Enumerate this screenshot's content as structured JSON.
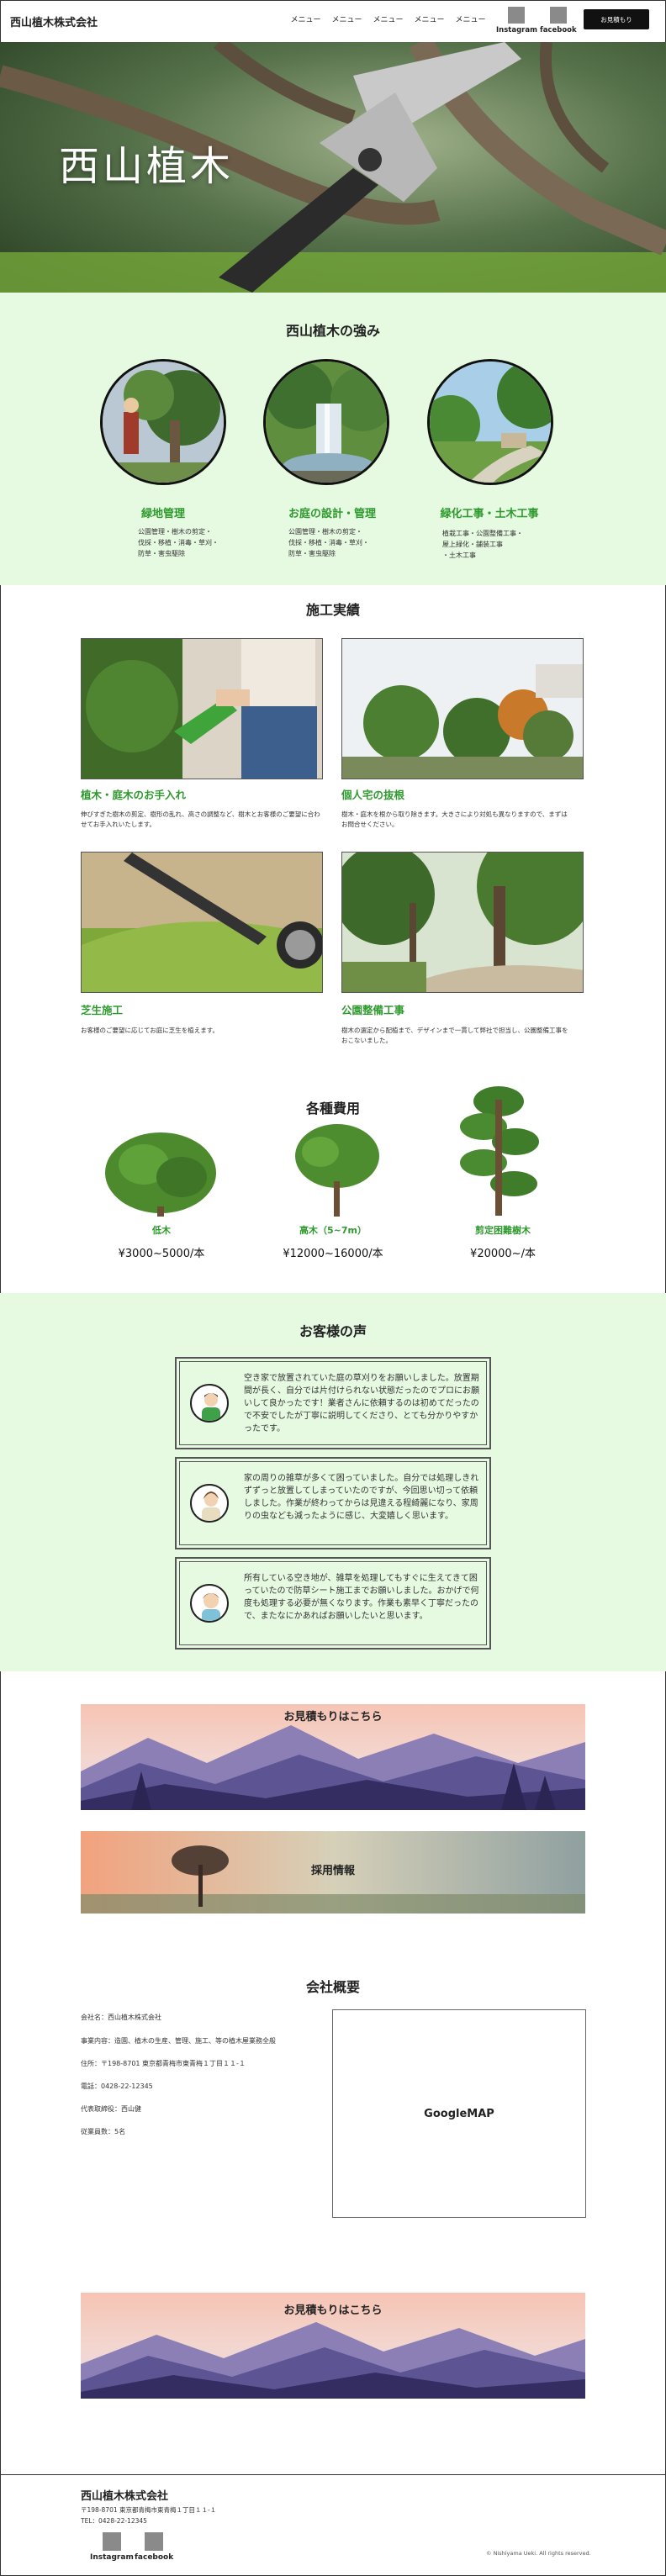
{
  "header": {
    "brand": "西山植木株式会社",
    "nav": [
      "メニュー",
      "メニュー",
      "メニュー",
      "メニュー",
      "メニュー"
    ],
    "social": [
      "Instagram",
      "facebook"
    ],
    "cta": "お見積もり"
  },
  "hero": {
    "title": "西山植木"
  },
  "strengths": {
    "title": "西山植木の強み",
    "items": [
      {
        "title": "緑地管理",
        "desc": [
          "公園管理・樹木の剪定・",
          "伐採・移植・消毒・草刈・",
          "防草・害虫駆除"
        ]
      },
      {
        "title": "お庭の設計・管理",
        "desc": [
          "公園管理・樹木の剪定・",
          "伐採・移植・消毒・草刈・",
          "防草・害虫駆除"
        ]
      },
      {
        "title": "緑化工事・土木工事",
        "desc": [
          "植栽工事・公園整備工事・",
          "屋上緑化・舗装工事",
          "・土木工事"
        ]
      }
    ]
  },
  "works": {
    "title": "施工実績",
    "items": [
      {
        "title": "植木・庭木のお手入れ",
        "desc": [
          "伸びすぎた樹木の剪定、樹形の乱れ、高さの調整など、樹木とお客様のご要望に合わ",
          "せてお手入れいたします。"
        ]
      },
      {
        "title": "個人宅の抜根",
        "desc": [
          "樹木・庭木を根から取り除きます。大きさにより対処も異なりますので、まずは",
          "お問合せください。"
        ]
      },
      {
        "title": "芝生施工",
        "desc": [
          "お客様のご要望に応じてお庭に芝生を植えます。"
        ]
      },
      {
        "title": "公園整備工事",
        "desc": [
          "樹木の選定から配植まで、デザインまで一貫して弊社で担当し、公園整備工事を",
          "おこないました。"
        ]
      }
    ]
  },
  "costs": {
    "title": "各種費用",
    "items": [
      {
        "name": "低木",
        "price": "¥3000~5000/本"
      },
      {
        "name": "高木（5~7m）",
        "price": "¥12000~16000/本"
      },
      {
        "name": "剪定困難樹木",
        "price": "¥20000~/本"
      }
    ]
  },
  "voices": {
    "title": "お客様の声",
    "items": [
      {
        "text": "空き家で放置されていた庭の草刈りをお願いしました。放置期間が長く、自分では片付けられない状態だったのでプロにお願いして良かったです！業者さんに依頼するのは初めてだったので不安でしたが丁寧に説明してくださり、とても分かりやすかったです。"
      },
      {
        "text": "家の周りの雑草が多くて困っていました。自分では処理しきれずずっと放置してしまっていたのですが、今回思い切って依頼しました。作業が終わってからは見違える程綺麗になり、家周りの虫なども減ったように感じ、大変嬉しく思います。"
      },
      {
        "text": "所有している空き地が、雑草を処理してもすぐに生えてきて困っていたので防草シート施工までお願いしました。おかげで何度も処理する必要が無くなります。作業も素早く丁寧だったので、またなにかあればお願いしたいと思います。"
      }
    ]
  },
  "banners": {
    "estimate": "お見積もりはこちら",
    "recruit": "採用情報",
    "estimate2": "お見積もりはこちら"
  },
  "company": {
    "title": "会社概要",
    "lines": [
      "会社名：西山植木株式会社",
      "事業内容：造園、植木の生産、管理、施工、等の植木屋業務全般",
      "住所：〒198-8701 東京都青梅市東青梅１丁目１１-１",
      "電話：0428-22-12345",
      "代表取締役：西山健",
      "従業員数：5名"
    ],
    "map": "GoogleMAP"
  },
  "footer": {
    "name": "西山植木株式会社",
    "address": "〒198-8701 東京都青梅市東青梅１丁目１１-１",
    "tel": "TEL：0428-22-12345",
    "social": [
      "Instagram",
      "facebook"
    ],
    "copyright": "© Nishiyama Ueki. All rights reserved."
  },
  "colors": {
    "accent_green": "#2e9a2e",
    "section_bg": "#e6f9e1",
    "cta_bg": "#111111"
  }
}
